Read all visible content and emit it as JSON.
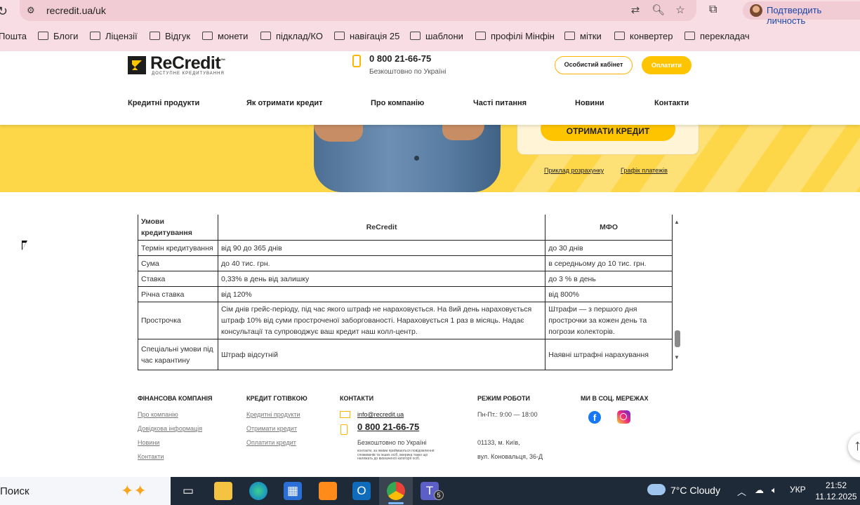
{
  "browser": {
    "url": "recredit.ua/uk",
    "profile_label": "Подтвердить личность",
    "bookmarks": [
      "Пошта",
      "Блоги",
      "Ліцензії",
      "Відгук",
      "монети",
      "підклад/КО",
      "навігація 25",
      "шаблони",
      "профілі Мінфін",
      "мітки",
      "конвертер",
      "перекладач"
    ]
  },
  "header": {
    "logo_text": "ReCredit",
    "logo_tm": "™",
    "logo_tagline": "ДОСТУПНЕ КРЕДИТУВАННЯ",
    "phone": "0 800 21-66-75",
    "phone_sub": "Безкоштовно по Україні",
    "cabinet_label": "Особистий кабінет",
    "pay_label": "Оплатити",
    "nav": [
      "Кредитні продукти",
      "Як отримати кредит",
      "Про компанію",
      "Часті питання",
      "Новини",
      "Контакти"
    ]
  },
  "hero": {
    "cta_label": "ОТРИМАТИ КРЕДИТ",
    "link_example": "Приклад розрахунку",
    "link_schedule": "Графік платежів"
  },
  "table": {
    "headers": [
      "Умови кредитування",
      "ReCredit",
      "МФО"
    ],
    "rows": [
      [
        "Термін кредитування",
        "від 90 до 365 днів",
        "до 30 днів"
      ],
      [
        "Сума",
        "до 40 тис. грн.",
        "в середньому до 10 тис. грн."
      ],
      [
        "Ставка",
        "0,33% в день від залишку",
        "до 3 % в день"
      ],
      [
        "Річна ставка",
        "від 120%",
        " від 800%"
      ],
      [
        "Прострочка",
        "Сім днів грейс-періоду, під час якого штраф не нараховується. На 8ий день нараховується штраф 10% від суми простроченої заборгованості. Нараховується 1 раз в місяць. Надає консультації та супроводжує ваш кредит наш колл-центр.",
        "Штрафи — з першого дня прострочки за кожен день та погрози колекторів."
      ],
      [
        "Спеціальні умови під час карантину",
        "Штраф відсутній",
        "Наявні штрафні нарахування"
      ]
    ]
  },
  "footer": {
    "col1": {
      "title": "ФІНАНСОВА КОМПАНІЯ",
      "links": [
        "Про компанію",
        "Довідкова інформація",
        "Новини",
        "Контакти"
      ]
    },
    "col2": {
      "title": "КРЕДИТ ГОТІВКОЮ",
      "links": [
        "Кредитні продукти",
        "Отримати кредит",
        "Оплатити кредит"
      ]
    },
    "col3": {
      "title": "КОНТАКТИ",
      "email": "info@recredit.ua",
      "phone": "0 800 21-66-75",
      "phone_sub": "Безкоштовно по Україні",
      "fine_print": "контакти, за якими приймаються повідомлення споживачів та інших осіб, вкерика такко що належать до визначеної категорії осіб."
    },
    "col4": {
      "title": "РЕЖИМ РОБОТИ",
      "hours": "Пн-Пт.: 9:00 — 18:00",
      "address1": "01133, м. Київ,",
      "address2": "вул. Коновальця, 36-Д"
    },
    "col5": {
      "title": "МИ В СОЦ. МЕРЕЖАХ"
    }
  },
  "taskbar": {
    "search_label": "Поиск",
    "teams_badge": "5",
    "weather": "7°C  Cloudy",
    "lang": "УКР",
    "time": "21:52",
    "date": "11.12.2025"
  }
}
